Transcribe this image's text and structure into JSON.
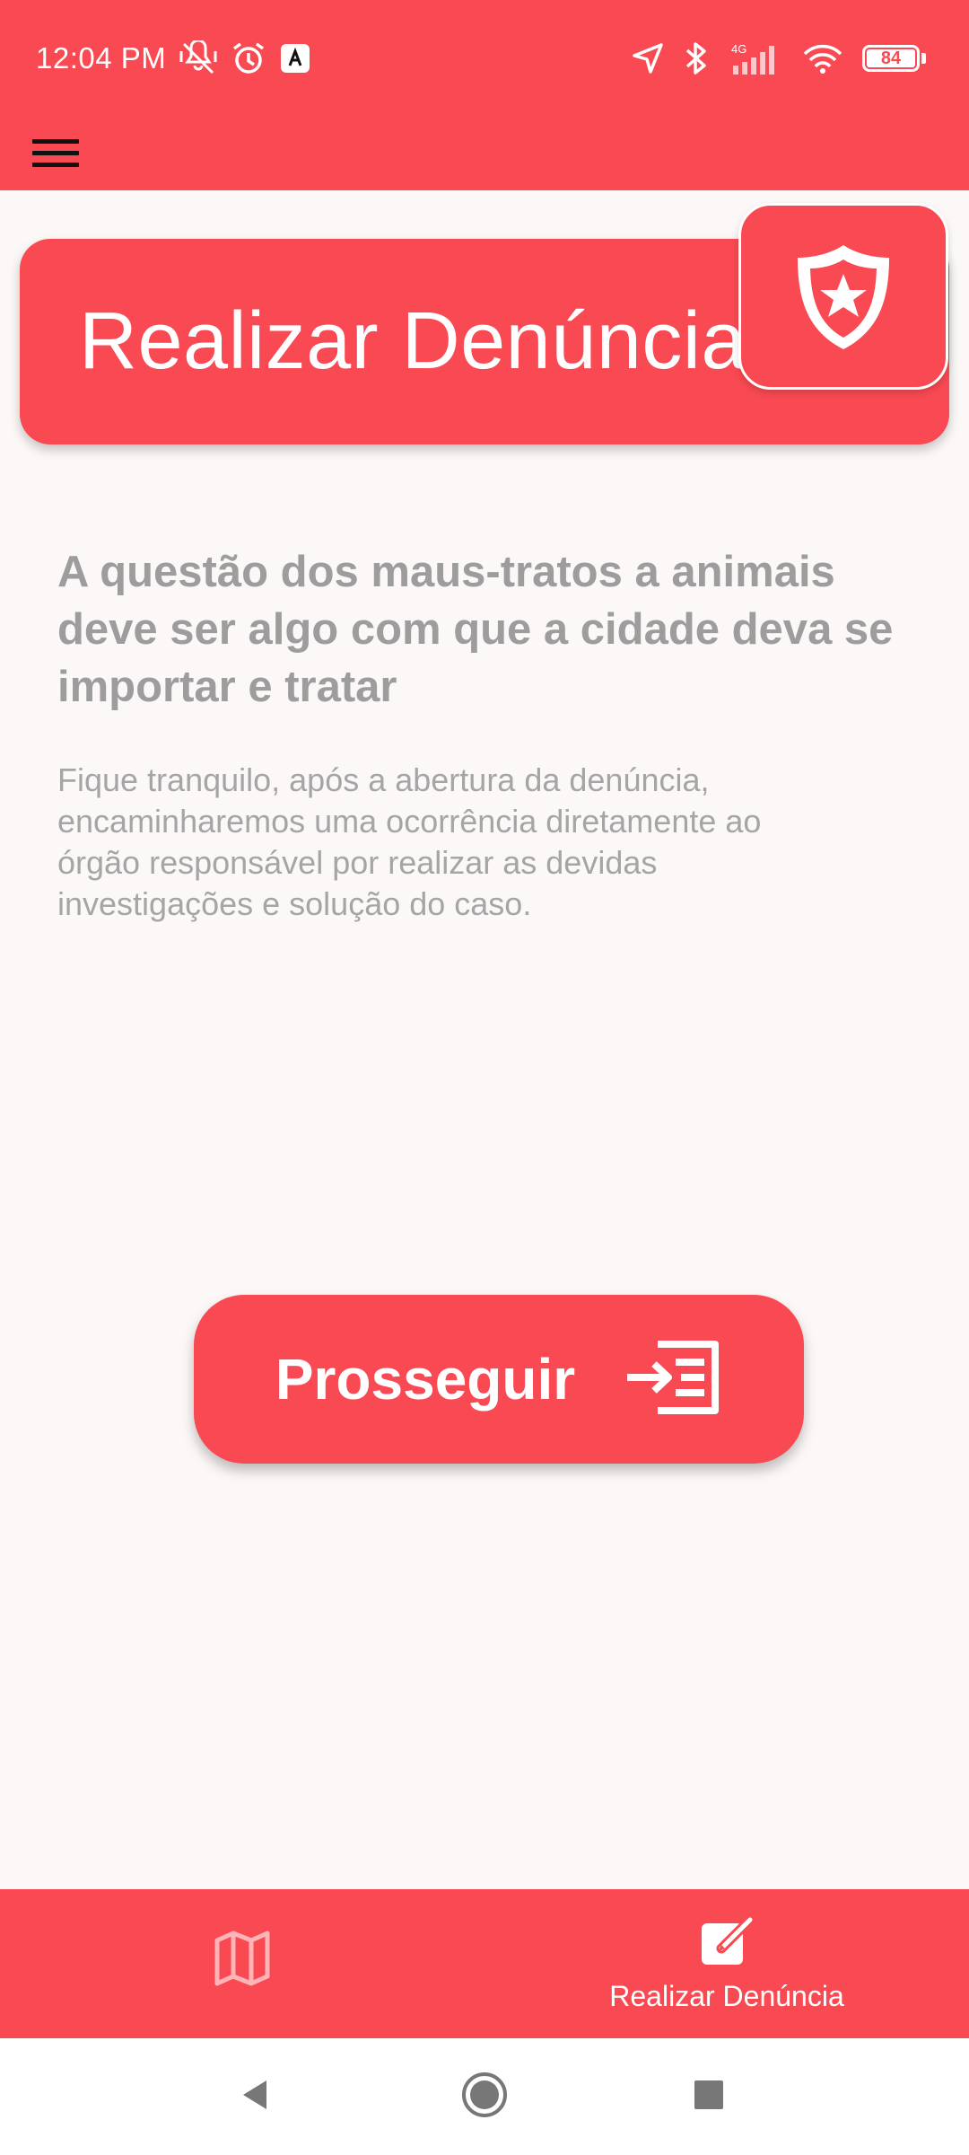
{
  "status_bar": {
    "time": "12:04 PM",
    "network": "4G",
    "battery": "84"
  },
  "header": {
    "title": "Realizar Denúncia",
    "badge_icon": "police-badge-icon"
  },
  "content": {
    "headline": "A questão dos maus-tratos a animais deve ser algo com que a cidade deva se importar e tratar",
    "description": "Fique tranquilo, após a abertura da denúncia, encaminharemos uma ocorrência diretamente ao órgão responsável por realizar as devidas investigações e solução do caso."
  },
  "proceed_button": {
    "label": "Prosseguir",
    "icon": "form-input-icon"
  },
  "bottom_nav": {
    "items": [
      {
        "icon": "map-icon",
        "label": ""
      },
      {
        "icon": "edit-note-icon",
        "label": "Realizar Denúncia"
      }
    ]
  },
  "colors": {
    "primary": "#f94952",
    "background": "#fcf8f7",
    "text_muted": "#9d9d9d"
  }
}
